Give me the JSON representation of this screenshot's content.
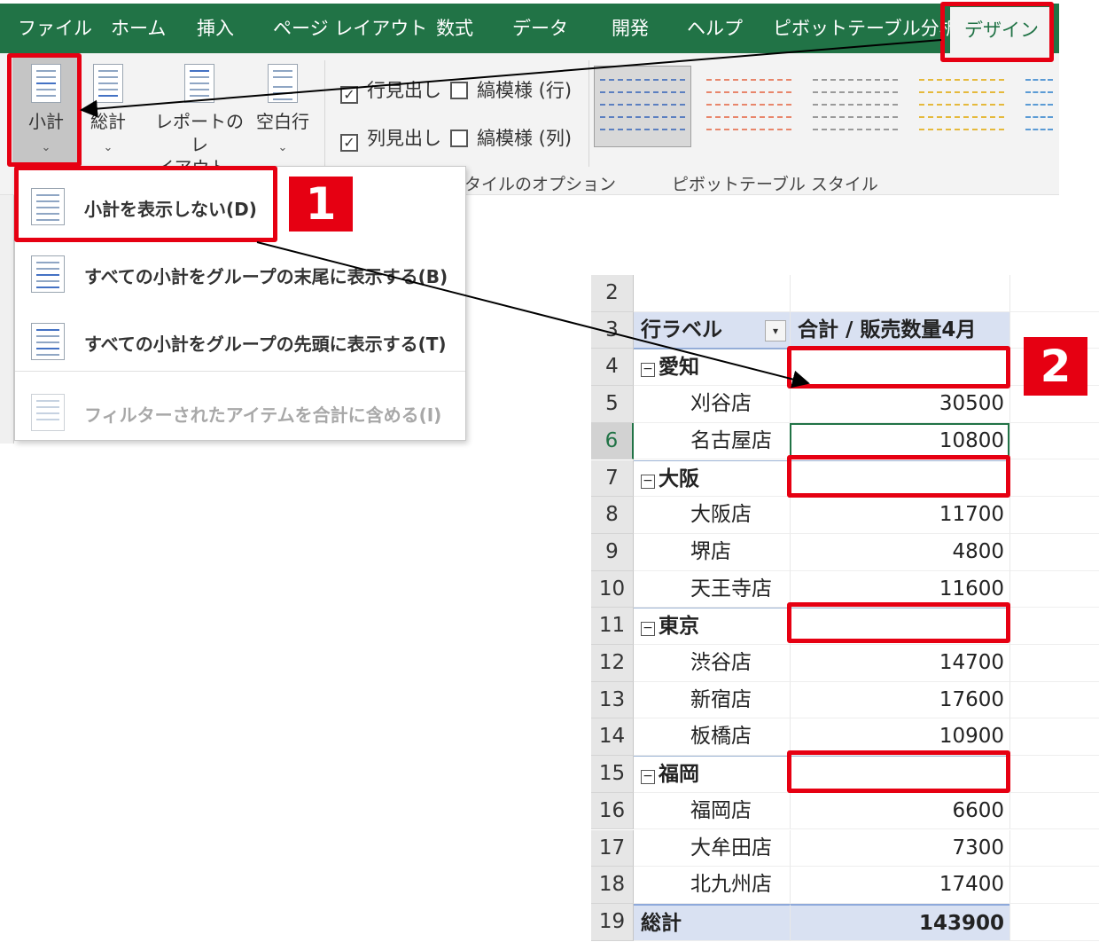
{
  "ribbon_tabs": [
    "ファイル",
    "ホーム",
    "挿入",
    "ページ レイアウト",
    "数式",
    "データ",
    "開発",
    "ヘルプ",
    "ピボットテーブル分析",
    "デザイン"
  ],
  "layout_buttons": {
    "subtotal": "小計",
    "grand_total": "総計",
    "report_layout_1": "レポートのレ",
    "report_layout_2": "イアウト",
    "blank_rows": "空白行"
  },
  "style_options": {
    "row_headers": "行見出し",
    "banded_rows": "縞模様 (行)",
    "column_headers": "列見出し",
    "banded_columns": "縞模様 (列)",
    "row_headers_checked": true,
    "column_headers_checked": true,
    "banded_rows_checked": false,
    "banded_columns_checked": false
  },
  "group_labels": {
    "style_options": "タイルのオプション",
    "pivot_styles": "ピボットテーブル スタイル"
  },
  "style_swatch_colors": [
    "#5b7fc0",
    "#e8866b",
    "#9a9a9a",
    "#e5b93b",
    "#5b9bd5"
  ],
  "subtotal_menu": [
    {
      "label": "小計を表示しない(D)",
      "enabled": true
    },
    {
      "label": "すべての小計をグループの末尾に表示する(B)",
      "enabled": true
    },
    {
      "label": "すべての小計をグループの先頭に表示する(T)",
      "enabled": true
    },
    {
      "label": "フィルターされたアイテムを合計に含める(I)",
      "enabled": false
    }
  ],
  "badges": {
    "one": "1",
    "two": "2"
  },
  "check_mark": "✓",
  "collapse_glyph": "−",
  "chevron": "⌄",
  "pivot": {
    "header": {
      "row_num": "3",
      "label": "行ラベル",
      "value_header": "合計 / 販売数量4月"
    },
    "rows": [
      {
        "num": "2",
        "type": "blank",
        "label": "",
        "value": ""
      },
      {
        "num": "4",
        "type": "group",
        "label": "愛知",
        "value": ""
      },
      {
        "num": "5",
        "type": "store",
        "label": "刈谷店",
        "value": "30500"
      },
      {
        "num": "6",
        "type": "store",
        "label": "名古屋店",
        "value": "10800"
      },
      {
        "num": "7",
        "type": "group",
        "label": "大阪",
        "value": ""
      },
      {
        "num": "8",
        "type": "store",
        "label": "大阪店",
        "value": "11700"
      },
      {
        "num": "9",
        "type": "store",
        "label": "堺店",
        "value": "4800"
      },
      {
        "num": "10",
        "type": "store",
        "label": "天王寺店",
        "value": "11600"
      },
      {
        "num": "11",
        "type": "group",
        "label": "東京",
        "value": ""
      },
      {
        "num": "12",
        "type": "store",
        "label": "渋谷店",
        "value": "14700"
      },
      {
        "num": "13",
        "type": "store",
        "label": "新宿店",
        "value": "17600"
      },
      {
        "num": "14",
        "type": "store",
        "label": "板橋店",
        "value": "10900"
      },
      {
        "num": "15",
        "type": "group",
        "label": "福岡",
        "value": ""
      },
      {
        "num": "16",
        "type": "store",
        "label": "福岡店",
        "value": "6600"
      },
      {
        "num": "17",
        "type": "store",
        "label": "大牟田店",
        "value": "7300"
      },
      {
        "num": "18",
        "type": "store",
        "label": "北九州店",
        "value": "17400"
      },
      {
        "num": "19",
        "type": "total",
        "label": "総計",
        "value": "143900"
      }
    ],
    "active_row": "6"
  }
}
